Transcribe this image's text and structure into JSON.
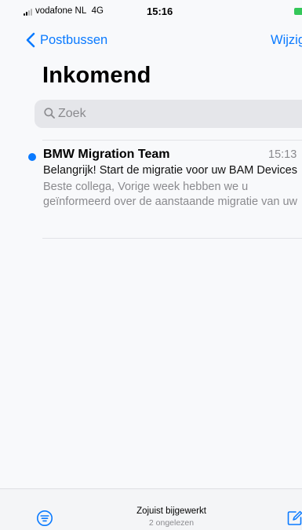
{
  "status_bar": {
    "carrier": "vodafone NL",
    "network": "4G",
    "time": "15:16"
  },
  "nav": {
    "back_label": "Postbussen",
    "edit_label": "Wijzig"
  },
  "title": "Inkomend",
  "search": {
    "placeholder": "Zoek"
  },
  "messages": [
    {
      "sender": "BMW Migration Team",
      "time": "15:13",
      "subject": "Belangrijk! Start de migratie voor uw BAM Devices",
      "preview_line1": "Beste collega, Vorige week hebben we u",
      "preview_line2": "geïnformeerd over de aanstaande migratie van uw",
      "unread": true
    }
  ],
  "toolbar": {
    "status": "Zojuist bijgewerkt",
    "unread_count": "2 ongelezen"
  },
  "colors": {
    "accent": "#0a7aff",
    "battery": "#34c759"
  },
  "icons": {
    "back": "chevron-left-icon",
    "search": "search-icon",
    "filter": "filter-icon",
    "compose": "compose-icon"
  }
}
